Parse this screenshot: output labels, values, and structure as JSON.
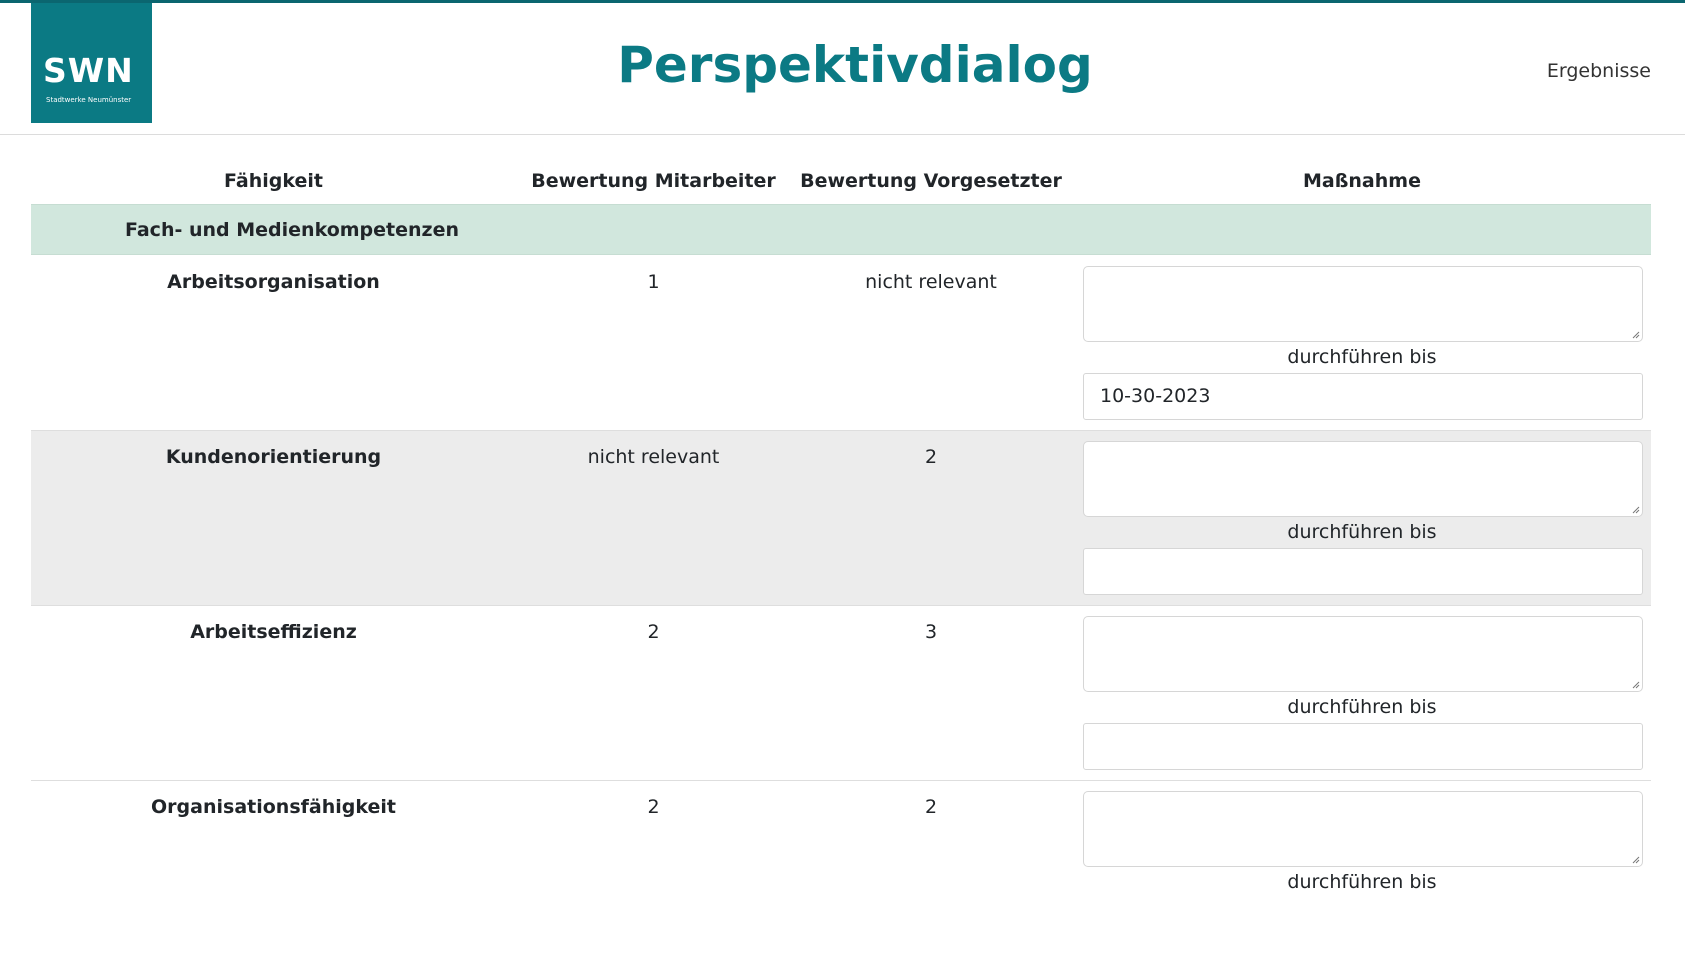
{
  "header": {
    "logo_text": "SWN",
    "logo_subtext": "Stadtwerke Neumünster",
    "title": "Perspektivdialog",
    "nav_results": "Ergebnisse"
  },
  "table": {
    "columns": [
      "Fähigkeit",
      "Bewertung Mitarbeiter",
      "Bewertung Vorgesetzter",
      "Maßnahme"
    ],
    "section": "Fach- und Medienkompetenzen",
    "due_label": "durchführen bis",
    "rows": [
      {
        "skill": "Arbeitsorganisation",
        "employee": "1",
        "supervisor": "nicht relevant",
        "measure": "",
        "due": "10-30-2023"
      },
      {
        "skill": "Kundenorientierung",
        "employee": "nicht relevant",
        "supervisor": "2",
        "measure": "",
        "due": ""
      },
      {
        "skill": "Arbeitseffizienz",
        "employee": "2",
        "supervisor": "3",
        "measure": "",
        "due": ""
      },
      {
        "skill": "Organisationsfähigkeit",
        "employee": "2",
        "supervisor": "2",
        "measure": "",
        "due": ""
      }
    ]
  },
  "colors": {
    "brand": "#0b7a84",
    "section_bg": "#d1e7dd",
    "shaded_row": "#ececec"
  }
}
